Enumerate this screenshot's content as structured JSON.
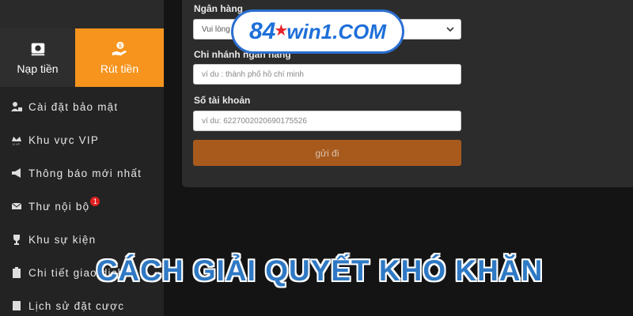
{
  "tabs": {
    "deposit_label": "Nạp tiền",
    "withdraw_label": "Rút tiền"
  },
  "menu": [
    {
      "label": "Cài đặt bảo mật",
      "icon": "user-lock-icon"
    },
    {
      "label": "Khu vực VIP",
      "icon": "vip-crown-icon"
    },
    {
      "label": "Thông báo mới nhất",
      "icon": "megaphone-icon"
    },
    {
      "label": "Thư nội bộ",
      "icon": "envelope-icon",
      "badge": "1"
    },
    {
      "label": "Khu sự kiện",
      "icon": "trophy-icon"
    },
    {
      "label": "Chi tiết giao dịch",
      "icon": "clipboard-icon"
    },
    {
      "label": "Lịch sử đặt cược",
      "icon": "document-icon"
    }
  ],
  "form": {
    "bank_label": "Ngân hàng",
    "bank_select_value": "Vui lòng",
    "branch_label": "Chi nhánh ngân hàng",
    "branch_placeholder": "ví du : thành phố hồ chí minh",
    "account_label": "Số tài khoản",
    "account_placeholder": "ví du:  6227002020690175526",
    "submit_label": "gửi đi"
  },
  "logo": {
    "number": "84",
    "text": "win1.COM"
  },
  "headline": "CÁCH GIẢI QUYẾT KHÓ KHĂN",
  "colors": {
    "accent": "#f7941d",
    "submit": "#a85a1d",
    "brand_blue": "#1e6fd9",
    "badge": "#e02020"
  }
}
